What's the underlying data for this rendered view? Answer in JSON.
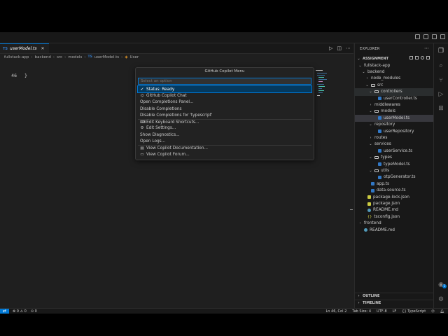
{
  "editor": {
    "tab": {
      "icon": "TS",
      "label": "userModel.ts",
      "close": "✕"
    },
    "breadcrumb": [
      "fullstack-app",
      "backend",
      "src",
      "models",
      "userModel.ts",
      "User"
    ],
    "breadcrumb_sep": "›",
    "line": {
      "number": "46",
      "text": "}"
    }
  },
  "palette": {
    "title": "GitHub Copilot Menu",
    "placeholder": "Select an option",
    "items": [
      {
        "icon": "check-circle-icon",
        "label": "Status: Ready"
      },
      {
        "icon": "copilot-icon",
        "label": "GitHub Copilot Chat"
      },
      {
        "icon": "",
        "label": "Open Completions Panel..."
      },
      {
        "icon": "",
        "label": "Disable Completions"
      },
      {
        "icon": "",
        "label": "Disable Completions for 'typescript'"
      },
      {
        "icon": "keyboard-icon",
        "label": "Edit Keyboard Shortcuts..."
      },
      {
        "icon": "gear-icon",
        "label": "Edit Settings..."
      },
      {
        "icon": "",
        "label": "Show Diagnostics..."
      },
      {
        "icon": "",
        "label": "Open Logs..."
      },
      {
        "icon": "book-icon",
        "label": "View Copilot Documentation..."
      },
      {
        "icon": "comment-icon",
        "label": "View Copilot Forum..."
      }
    ]
  },
  "explorer": {
    "title": "EXPLORER",
    "section": "ASSIGNMENT",
    "tree": [
      {
        "label": "fullstack-app",
        "kind": "folder-open"
      },
      {
        "label": "backend",
        "kind": "folder-open"
      },
      {
        "label": "node_modules",
        "kind": "folder-closed"
      },
      {
        "label": "src",
        "kind": "folder-open"
      },
      {
        "label": "controllers",
        "kind": "folder-open"
      },
      {
        "label": "userController.ts",
        "kind": "ts"
      },
      {
        "label": "middlewares",
        "kind": "folder-closed"
      },
      {
        "label": "models",
        "kind": "folder-open"
      },
      {
        "label": "userModel.ts",
        "kind": "ts"
      },
      {
        "label": "repository",
        "kind": "folder-open"
      },
      {
        "label": "userRepository",
        "kind": "ts"
      },
      {
        "label": "routes",
        "kind": "folder-closed"
      },
      {
        "label": "services",
        "kind": "folder-open"
      },
      {
        "label": "userService.ts",
        "kind": "ts"
      },
      {
        "label": "types",
        "kind": "folder-open"
      },
      {
        "label": "typeModel.ts",
        "kind": "ts"
      },
      {
        "label": "utils",
        "kind": "folder-open"
      },
      {
        "label": "otpGenerator.ts",
        "kind": "ts"
      },
      {
        "label": "app.ts",
        "kind": "ts"
      },
      {
        "label": "data-source.ts",
        "kind": "ts"
      },
      {
        "label": "package-lock.json",
        "kind": "json"
      },
      {
        "label": "package.json",
        "kind": "json"
      },
      {
        "label": "README.md",
        "kind": "md"
      },
      {
        "label": "tsconfig.json",
        "kind": "cfg"
      },
      {
        "label": "frontend",
        "kind": "folder-closed"
      },
      {
        "label": "README.md",
        "kind": "md"
      }
    ],
    "outline": "OUTLINE",
    "timeline": "TIMELINE"
  },
  "statusbar": {
    "remote": "⇄",
    "errors": "0",
    "warnings": "0",
    "ports": "0",
    "position": "Ln 46, Col 2",
    "tab_size": "Tab Size: 4",
    "encoding": "UTF-8",
    "eol": "LF",
    "language": "TypeScript"
  },
  "colors": {
    "accent": "#0078d4",
    "background": "#1f1f1f",
    "sidebar": "#181818",
    "selection": "#04395e"
  }
}
